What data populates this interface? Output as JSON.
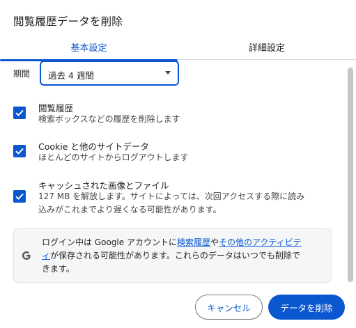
{
  "dialog": {
    "title": "閲覧履歴データを削除"
  },
  "tabs": [
    {
      "label": "基本設定",
      "active": true
    },
    {
      "label": "詳細設定",
      "active": false
    }
  ],
  "period": {
    "label": "期間",
    "value": "過去 4 週間"
  },
  "options": [
    {
      "title": "閲覧履歴",
      "description": "検索ボックスなどの履歴を削除します",
      "checked": true
    },
    {
      "title": "Cookie と他のサイトデータ",
      "description": "ほとんどのサイトからログアウトします",
      "checked": true
    },
    {
      "title": "キャッシュされた画像とファイル",
      "description_line1": "127 MB を解放します。サイトによっては、次回アクセスする際に読み",
      "description_line2": "込みがこれまでより遅くなる可能性があります。",
      "checked": true
    }
  ],
  "info": {
    "icon": "google-g-icon",
    "text_before": "ログイン中は Google アカウントに",
    "link1": "検索履歴",
    "text_mid": "や",
    "link2": "その他のアクティビテ",
    "link2b": "ィ",
    "text_after": "が保存される可能性があります。これらのデータはいつでも削除で",
    "text_last": "きます。"
  },
  "buttons": {
    "cancel": "キャンセル",
    "delete": "データを削除"
  },
  "colors": {
    "accent": "#0b57d0",
    "text": "#1f1f1f",
    "secondary_text": "#444746"
  }
}
